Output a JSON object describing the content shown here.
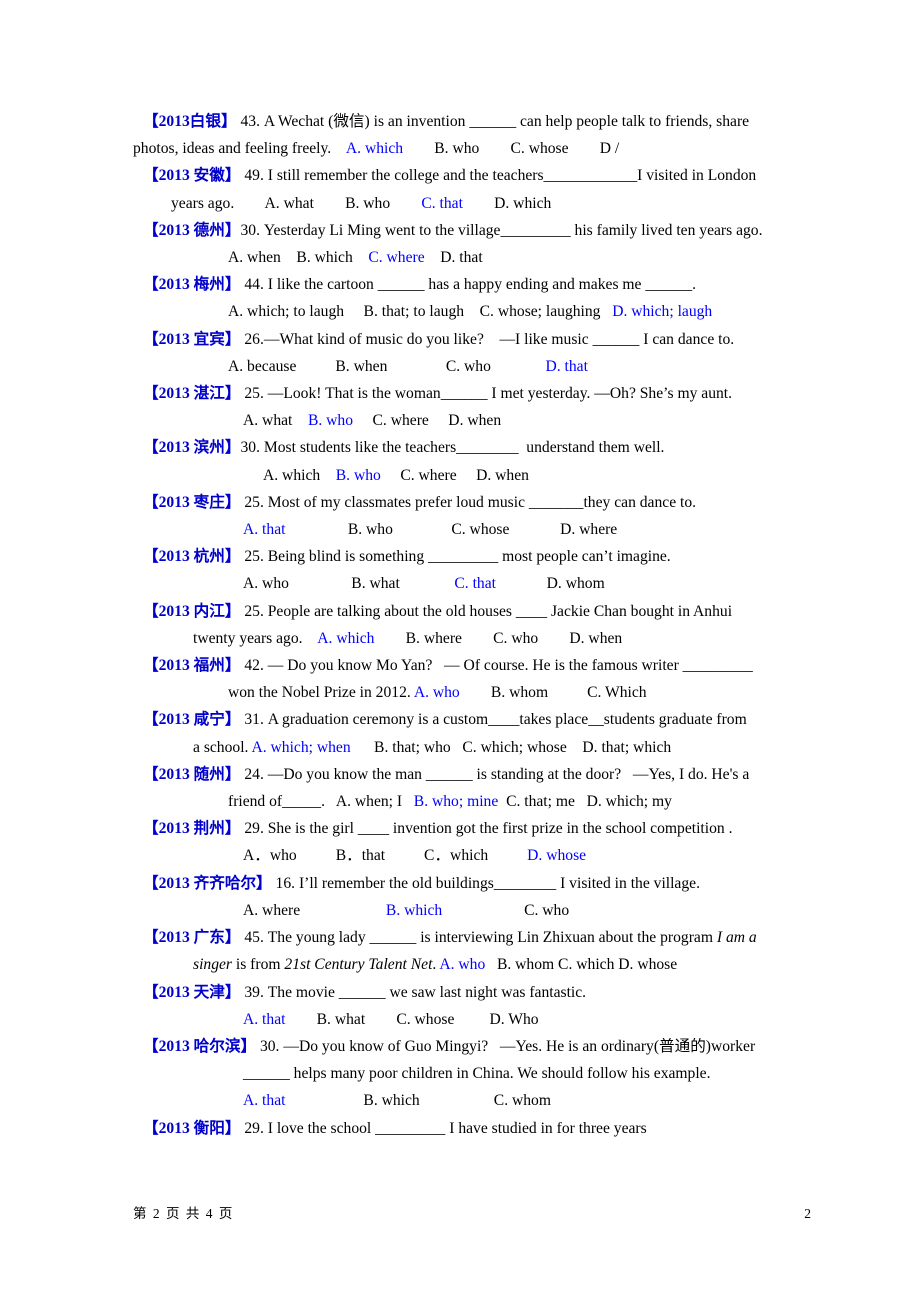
{
  "document": {
    "page_number_display": "2",
    "footer_left": "第 2 页 共 4 页",
    "tag_color": "#0000CC",
    "answer_color": "#0000FF",
    "text_color": "#000000"
  },
  "questions": [
    {
      "tag": "【2013白银】",
      "lines": [
        {
          "segments": [
            {
              "t": "tag",
              "v": "【2013白银】"
            },
            {
              "t": "text",
              "v": " 43. A Wechat (微信) is an invention ______ can help people talk to friends, share"
            }
          ]
        },
        {
          "segments": [
            {
              "t": "text",
              "v": "photos, ideas and feeling freely.    "
            },
            {
              "t": "ans",
              "v": "A. which"
            },
            {
              "t": "text",
              "v": "        B. who        C. whose        D /"
            }
          ]
        }
      ]
    },
    {
      "tag": "【2013 安徽】",
      "lines": [
        {
          "segments": [
            {
              "t": "tag",
              "v": "【2013 安徽】"
            },
            {
              "t": "text",
              "v": " 49. I still remember the college and the teachers____________I visited in London"
            }
          ]
        },
        {
          "segments": [
            {
              "t": "text",
              "v": "years ago.        A. what        B. who        "
            },
            {
              "t": "ans",
              "v": "C. that"
            },
            {
              "t": "text",
              "v": "        D. which"
            }
          ]
        }
      ]
    },
    {
      "tag": "【2013 德州】",
      "lines": [
        {
          "segments": [
            {
              "t": "tag",
              "v": "【2013 德州】"
            },
            {
              "t": "text",
              "v": "30. Yesterday Li Ming went to the village_________ his family lived ten years ago."
            }
          ]
        },
        {
          "segments": [
            {
              "t": "text",
              "v": "A. when    B. which    "
            },
            {
              "t": "ans",
              "v": "C. where"
            },
            {
              "t": "text",
              "v": "    D. that"
            }
          ]
        }
      ]
    },
    {
      "tag": "【2013 梅州】",
      "lines": [
        {
          "segments": [
            {
              "t": "tag",
              "v": "【2013 梅州】"
            },
            {
              "t": "text",
              "v": " 44. I like the cartoon ______ has a happy ending and makes me ______."
            }
          ]
        },
        {
          "segments": [
            {
              "t": "text",
              "v": "A. which; to laugh     B. that; to laugh    C. whose; laughing   "
            },
            {
              "t": "ans",
              "v": "D. which; laugh"
            }
          ]
        }
      ]
    },
    {
      "tag": "【2013 宜宾】",
      "lines": [
        {
          "segments": [
            {
              "t": "tag",
              "v": "【2013 宜宾】"
            },
            {
              "t": "text",
              "v": " 26.—What kind of music do you like?    —I like music ______ I can dance to."
            }
          ]
        },
        {
          "segments": [
            {
              "t": "text",
              "v": "A. because          B. when               C. who              "
            },
            {
              "t": "ans",
              "v": "D. that"
            }
          ]
        }
      ]
    },
    {
      "tag": "【2013 湛江】",
      "lines": [
        {
          "segments": [
            {
              "t": "tag",
              "v": "【2013 湛江】"
            },
            {
              "t": "text",
              "v": " 25. —Look! That is the woman______ I met yesterday. —Oh? She’s my aunt."
            }
          ]
        },
        {
          "segments": [
            {
              "t": "text",
              "v": "A. what    "
            },
            {
              "t": "ans",
              "v": "B. who"
            },
            {
              "t": "text",
              "v": "     C. where     D. when"
            }
          ]
        }
      ]
    },
    {
      "tag": "【2013 滨州】",
      "lines": [
        {
          "segments": [
            {
              "t": "tag",
              "v": "【2013 滨州】"
            },
            {
              "t": "text",
              "v": "30. Most students like the teachers________  understand them well."
            }
          ]
        },
        {
          "segments": [
            {
              "t": "text",
              "v": "A. which    "
            },
            {
              "t": "ans",
              "v": "B. who"
            },
            {
              "t": "text",
              "v": "     C. where     D. when"
            }
          ]
        }
      ]
    },
    {
      "tag": "【2013 枣庄】",
      "lines": [
        {
          "segments": [
            {
              "t": "tag",
              "v": "【2013 枣庄】"
            },
            {
              "t": "text",
              "v": " 25. Most of my classmates prefer loud music _______they can dance to."
            }
          ]
        },
        {
          "segments": [
            {
              "t": "ans",
              "v": "A. that"
            },
            {
              "t": "text",
              "v": "                B. who               C. whose             D. where"
            }
          ]
        }
      ]
    },
    {
      "tag": "【2013 杭州】",
      "lines": [
        {
          "segments": [
            {
              "t": "tag",
              "v": "【2013 杭州】"
            },
            {
              "t": "text",
              "v": " 25. Being blind is something _________ most people can’t imagine."
            }
          ]
        },
        {
          "segments": [
            {
              "t": "text",
              "v": "A. who                B. what              "
            },
            {
              "t": "ans",
              "v": "C. that"
            },
            {
              "t": "text",
              "v": "             D. whom"
            }
          ]
        }
      ]
    },
    {
      "tag": "【2013 内江】",
      "lines": [
        {
          "segments": [
            {
              "t": "tag",
              "v": "【2013 内江】"
            },
            {
              "t": "text",
              "v": " 25. People are talking about the old houses ____ Jackie Chan bought in Anhui"
            }
          ]
        },
        {
          "segments": [
            {
              "t": "text",
              "v": "twenty years ago.    "
            },
            {
              "t": "ans",
              "v": "A. which"
            },
            {
              "t": "text",
              "v": "        B. where        C. who        D. when"
            }
          ]
        }
      ]
    },
    {
      "tag": "【2013 福州】",
      "lines": [
        {
          "segments": [
            {
              "t": "tag",
              "v": "【2013 福州】"
            },
            {
              "t": "text",
              "v": " 42. — Do you know Mo Yan?   — Of course. He is the famous writer _________"
            }
          ]
        },
        {
          "segments": [
            {
              "t": "text",
              "v": "won the Nobel Prize in 2012. "
            },
            {
              "t": "ans",
              "v": "A. who"
            },
            {
              "t": "text",
              "v": "        B. whom          C. Which"
            }
          ]
        }
      ]
    },
    {
      "tag": "【2013 咸宁】",
      "lines": [
        {
          "segments": [
            {
              "t": "tag",
              "v": "【2013 咸宁】"
            },
            {
              "t": "text",
              "v": " 31. A graduation ceremony is a custom____takes place__students graduate from"
            }
          ]
        },
        {
          "segments": [
            {
              "t": "text",
              "v": "a school. "
            },
            {
              "t": "ans",
              "v": "A. which; when"
            },
            {
              "t": "text",
              "v": "      B. that; who   C. which; whose    D. that; which"
            }
          ]
        }
      ]
    },
    {
      "tag": "【2013 随州】",
      "lines": [
        {
          "segments": [
            {
              "t": "tag",
              "v": "【2013 随州】"
            },
            {
              "t": "text",
              "v": " 24. —Do you know the man ______ is standing at the door?   —Yes, I do. He's a"
            }
          ]
        },
        {
          "segments": [
            {
              "t": "text",
              "v": "friend of_____.   A. when; I   "
            },
            {
              "t": "ans",
              "v": "B. who; mine"
            },
            {
              "t": "text",
              "v": "  C. that; me   D. which; my"
            }
          ]
        }
      ]
    },
    {
      "tag": "【2013 荆州】",
      "lines": [
        {
          "segments": [
            {
              "t": "tag",
              "v": "【2013 荆州】"
            },
            {
              "t": "text",
              "v": " 29. She is the girl ____ invention got the first prize in the school competition ."
            }
          ]
        },
        {
          "segments": [
            {
              "t": "text",
              "v": "A．who          B．that          C．which          "
            },
            {
              "t": "ans",
              "v": "D. whose"
            }
          ]
        }
      ]
    },
    {
      "tag": "【2013 齐齐哈尔】",
      "lines": [
        {
          "segments": [
            {
              "t": "tag",
              "v": "【2013 齐齐哈尔】"
            },
            {
              "t": "text",
              "v": " 16. I’ll remember the old buildings________ I visited in the village."
            }
          ]
        },
        {
          "segments": [
            {
              "t": "text",
              "v": "A. where                      "
            },
            {
              "t": "ans",
              "v": "B. which"
            },
            {
              "t": "text",
              "v": "                     C. who"
            }
          ]
        }
      ]
    },
    {
      "tag": "【2013 广东】",
      "lines": [
        {
          "segments": [
            {
              "t": "tag",
              "v": "【2013 广东】"
            },
            {
              "t": "text",
              "v": " 45. The young lady ______ is interviewing Lin Zhixuan about the program "
            },
            {
              "t": "it",
              "v": "I am a"
            }
          ]
        },
        {
          "segments": [
            {
              "t": "it",
              "v": "singer"
            },
            {
              "t": "text",
              "v": " is from "
            },
            {
              "t": "it",
              "v": "21st Century Talent Net"
            },
            {
              "t": "text",
              "v": ". "
            },
            {
              "t": "ans",
              "v": "A. who"
            },
            {
              "t": "text",
              "v": "   B. whom C. which D. whose"
            }
          ]
        }
      ]
    },
    {
      "tag": "【2013 天津】",
      "lines": [
        {
          "segments": [
            {
              "t": "tag",
              "v": "【2013 天津】"
            },
            {
              "t": "text",
              "v": " 39. The movie ______ we saw last night was fantastic."
            }
          ]
        },
        {
          "segments": [
            {
              "t": "ans",
              "v": "A. that"
            },
            {
              "t": "text",
              "v": "        B. what        C. whose         D. Who"
            }
          ]
        }
      ]
    },
    {
      "tag": "【2013 哈尔滨】",
      "lines": [
        {
          "segments": [
            {
              "t": "tag",
              "v": "【2013 哈尔滨】"
            },
            {
              "t": "text",
              "v": " 30. —Do you know of Guo Mingyi?   —Yes. He is an ordinary(普通的)worker"
            }
          ]
        },
        {
          "segments": [
            {
              "t": "text",
              "v": "______ helps many poor children in China. We should follow his example."
            }
          ]
        },
        {
          "segments": [
            {
              "t": "ans",
              "v": "A. that"
            },
            {
              "t": "text",
              "v": "                    B. which                   C. whom"
            }
          ]
        }
      ]
    },
    {
      "tag": "【2013 衡阳】",
      "lines": [
        {
          "segments": [
            {
              "t": "tag",
              "v": "【2013 衡阳】"
            },
            {
              "t": "text",
              "v": " 29. I love the school _________ I have studied in for three years"
            }
          ]
        }
      ]
    }
  ],
  "layout": {
    "line_indents": [
      [
        0,
        0
      ],
      [
        0,
        1
      ],
      [
        0,
        3
      ],
      [
        0,
        3
      ],
      [
        0,
        3
      ],
      [
        0,
        4
      ],
      [
        0,
        5
      ],
      [
        0,
        4
      ],
      [
        0,
        4
      ],
      [
        0,
        2
      ],
      [
        0,
        3
      ],
      [
        0,
        2
      ],
      [
        0,
        3
      ],
      [
        0,
        4
      ],
      [
        0,
        4
      ],
      [
        0,
        2
      ],
      [
        0,
        4
      ],
      [
        0,
        4,
        4
      ],
      [
        0
      ]
    ]
  }
}
